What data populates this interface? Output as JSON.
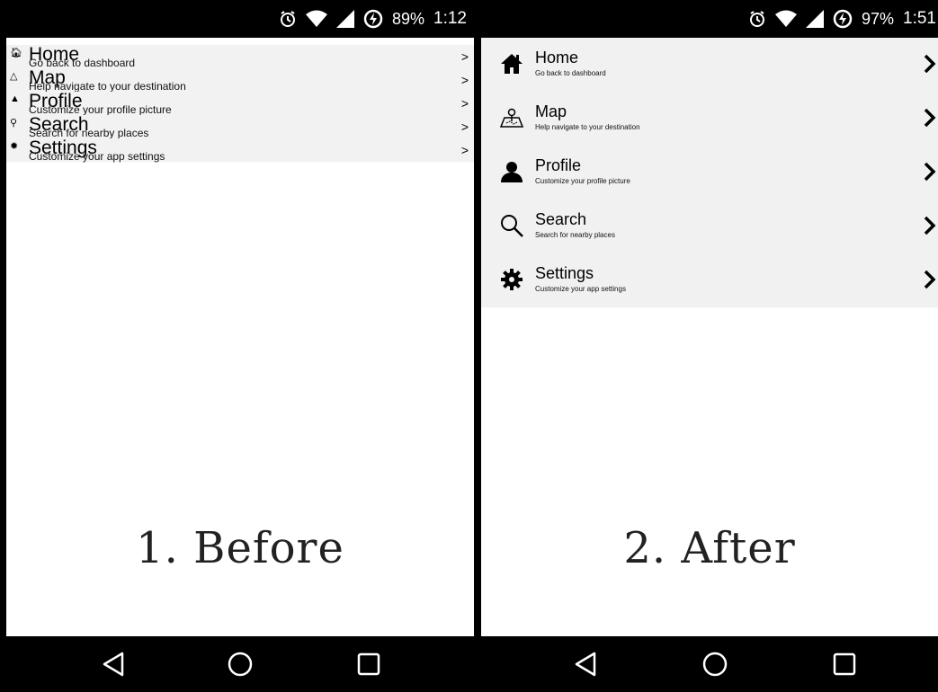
{
  "before": {
    "status": {
      "battery": "89%",
      "time": "1:12"
    },
    "caption": "1. Before",
    "items": [
      {
        "title": "Home",
        "subtitle": "Go back to dashboard",
        "icon": "home-icon"
      },
      {
        "title": "Map",
        "subtitle": "Help navigate to your destination",
        "icon": "map-icon"
      },
      {
        "title": "Profile",
        "subtitle": "Customize your profile picture",
        "icon": "person-icon"
      },
      {
        "title": "Search",
        "subtitle": "Search for nearby places",
        "icon": "search-icon"
      },
      {
        "title": "Settings",
        "subtitle": "Customize your app settings",
        "icon": "gear-icon"
      }
    ]
  },
  "after": {
    "status": {
      "battery": "97%",
      "time": "1:51"
    },
    "caption": "2. After",
    "items": [
      {
        "title": "Home",
        "subtitle": "Go back to dashboard",
        "icon": "home-icon"
      },
      {
        "title": "Map",
        "subtitle": "Help navigate to your destination",
        "icon": "map-icon"
      },
      {
        "title": "Profile",
        "subtitle": "Customize your profile picture",
        "icon": "person-icon"
      },
      {
        "title": "Search",
        "subtitle": "Search for nearby places",
        "icon": "search-icon"
      },
      {
        "title": "Settings",
        "subtitle": "Customize your app settings",
        "icon": "gear-icon"
      }
    ]
  }
}
